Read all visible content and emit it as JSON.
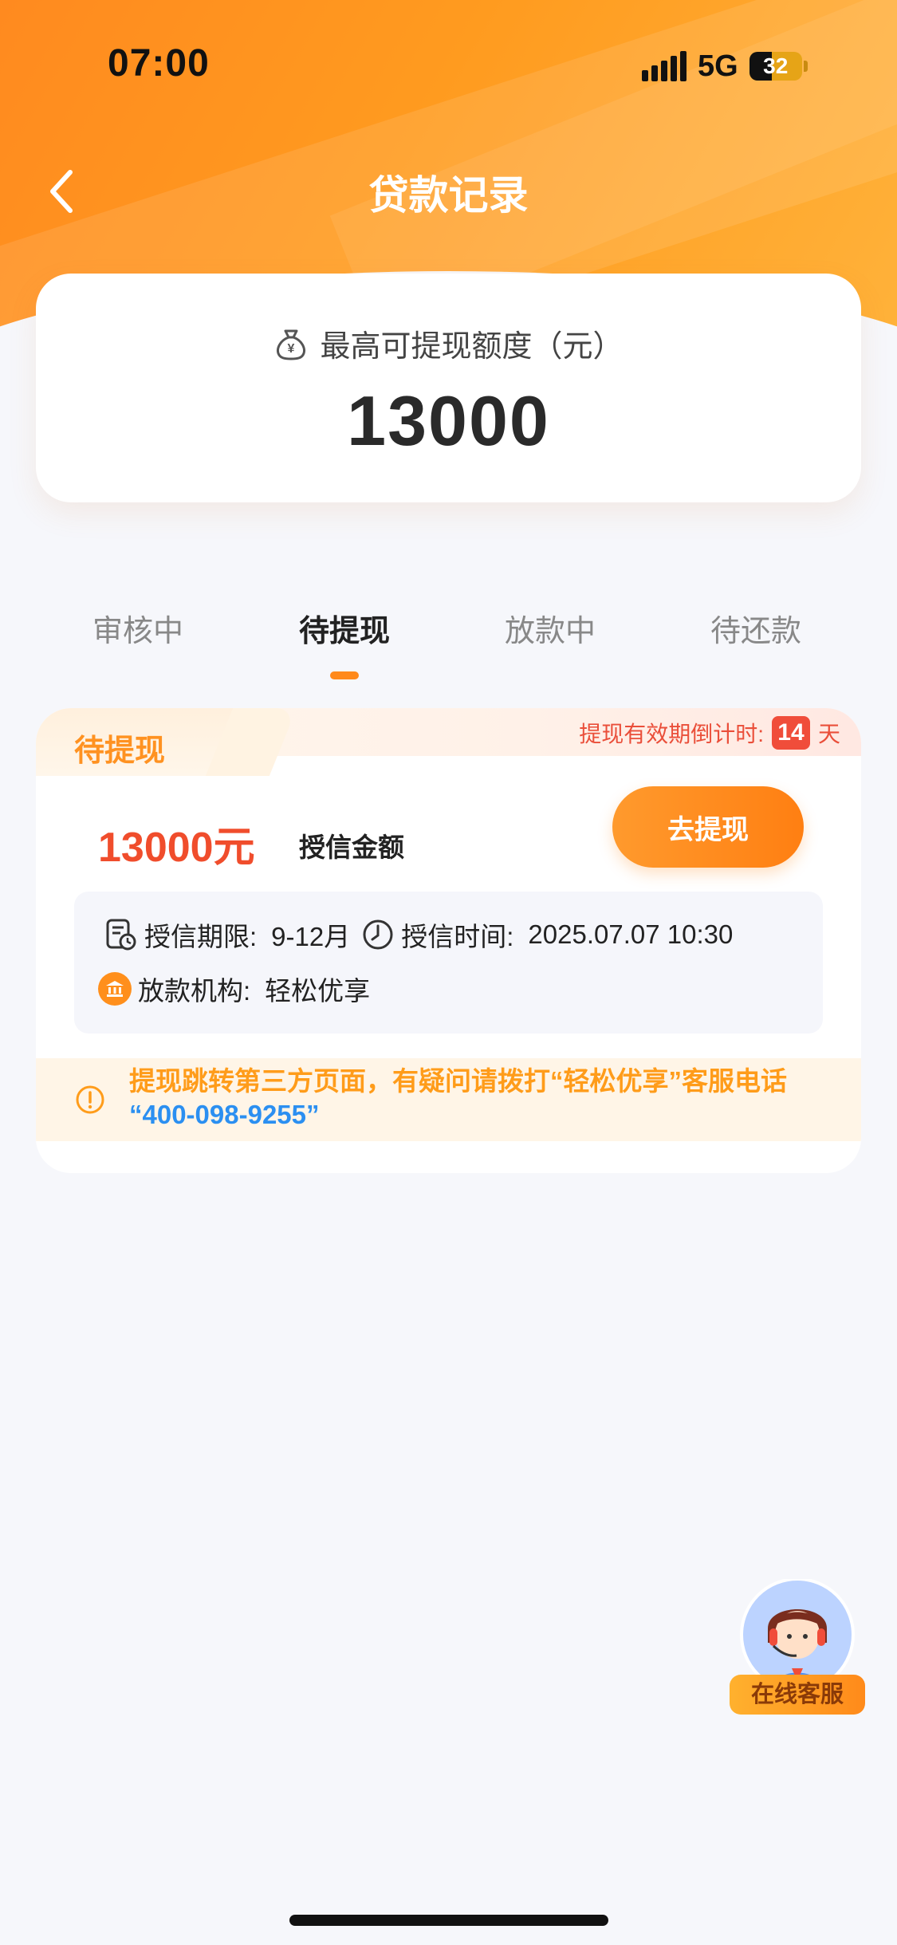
{
  "status_bar": {
    "time": "07:00",
    "network": "5G",
    "battery": "32"
  },
  "nav": {
    "title": "贷款记录"
  },
  "quota": {
    "label": "最高可提现额度（元）",
    "value": "13000"
  },
  "tabs": [
    {
      "label": "审核中",
      "active": false
    },
    {
      "label": "待提现",
      "active": true
    },
    {
      "label": "放款中",
      "active": false
    },
    {
      "label": "待还款",
      "active": false
    }
  ],
  "record": {
    "status": "待提现",
    "countdown_label": "提现有效期倒计时:",
    "countdown_value": "14",
    "countdown_unit": "天",
    "amount": "13000元",
    "amount_label": "授信金额",
    "button_label": "去提现",
    "term_label": "授信期限:",
    "term_value": "9-12月",
    "time_label": "授信时间:",
    "time_value": "2025.07.07 10:30",
    "org_label": "放款机构:",
    "org_value": "轻松优享",
    "notice_text": "提现跳转第三方页面，有疑问请拨打“轻松优享”客服电话",
    "notice_phone": "“400-098-9255”"
  },
  "customer_service": {
    "label": "在线客服"
  },
  "colors": {
    "brand_orange": "#ff8a1a",
    "amount_red": "#f04d2c",
    "notice_orange": "#ff9c1a",
    "link_blue": "#2b8ff1"
  }
}
